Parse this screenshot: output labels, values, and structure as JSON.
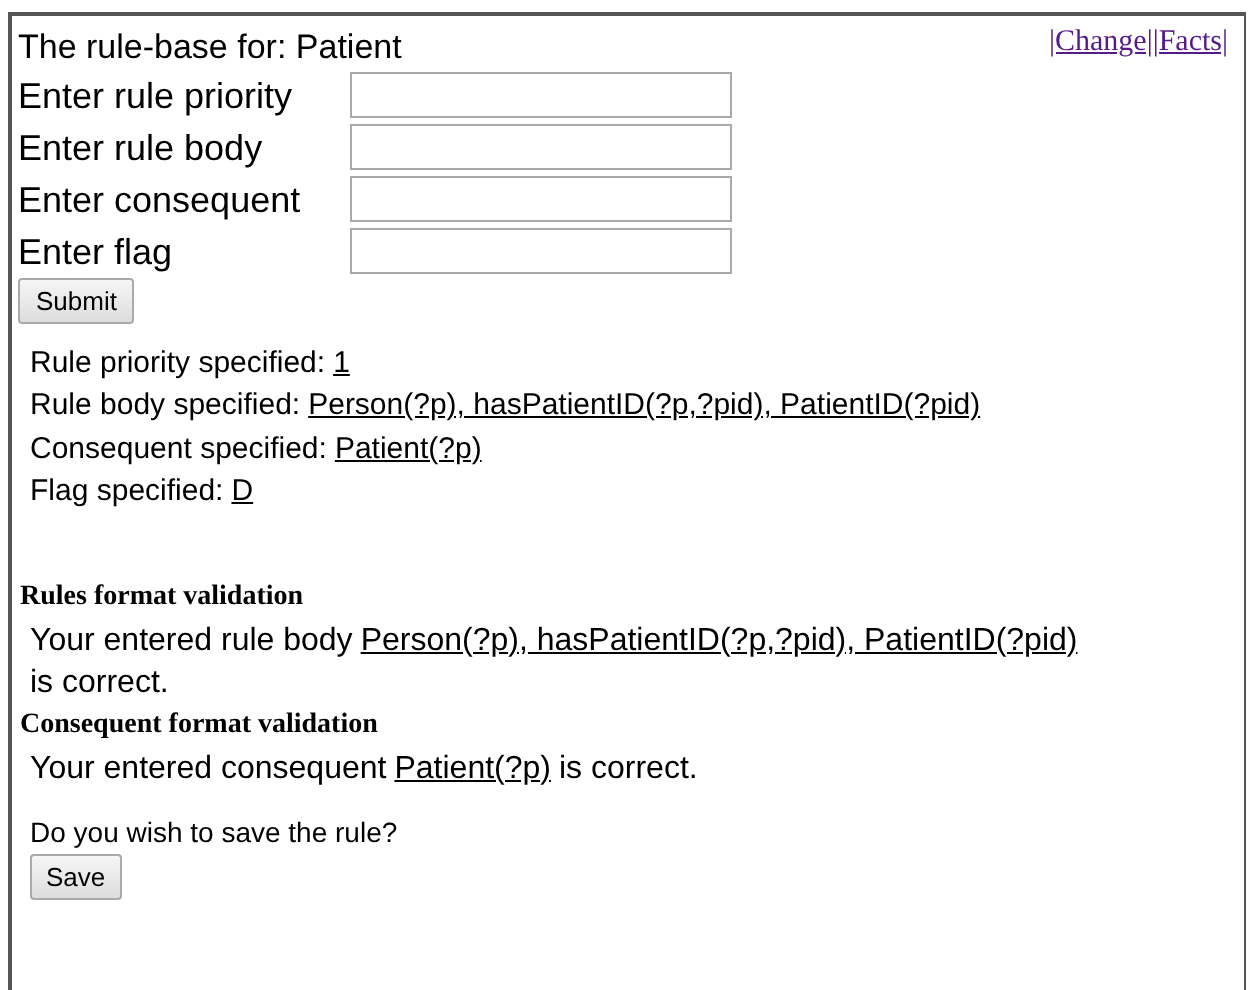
{
  "title": "The rule-base for: Patient",
  "nav_links": [
    "|Change|",
    "|Facts|"
  ],
  "form_fields": [
    {
      "label": "Enter rule priority"
    },
    {
      "label": "Enter rule body"
    },
    {
      "label": "Enter consequent"
    },
    {
      "label": "Enter flag"
    }
  ],
  "submit_button": "Submit",
  "specified": [
    {
      "label": "Rule priority specified:",
      "value": "1"
    },
    {
      "label": "Rule body specified:",
      "value": "Person(?p), hasPatientID(?p,?pid), PatientID(?pid)"
    },
    {
      "label": "Consequent specified:",
      "value": "Patient(?p)"
    },
    {
      "label": "Flag specified:",
      "value": "D"
    }
  ],
  "validations": [
    {
      "heading": "Rules format validation",
      "prefix": "Your entered rule body",
      "value": "Person(?p), hasPatientID(?p,?pid), PatientID(?pid)",
      "suffix": "is correct."
    },
    {
      "heading": "Consequent format validation",
      "prefix": "Your entered consequent",
      "value": "Patient(?p)",
      "suffix": "is correct."
    }
  ],
  "save_prompt": "Do you wish to save the rule?",
  "save_button": "Save"
}
